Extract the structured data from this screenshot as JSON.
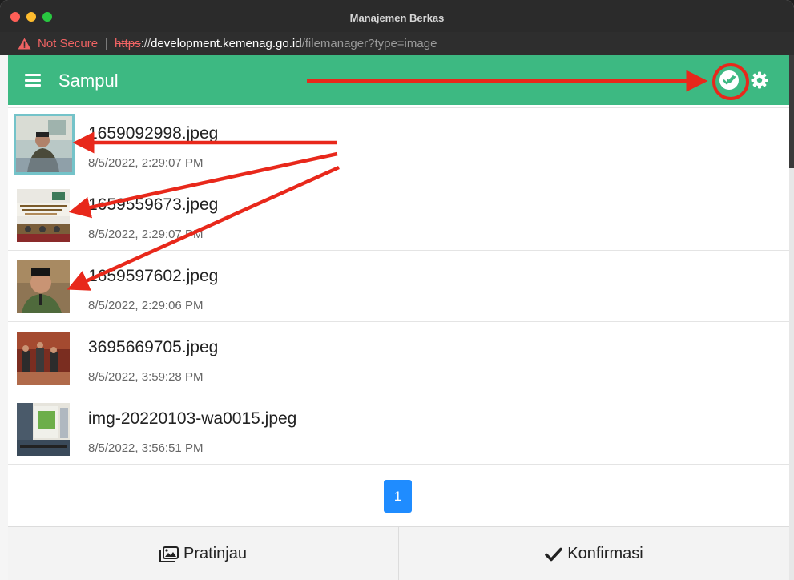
{
  "window": {
    "title": "Manajemen Berkas"
  },
  "address_bar": {
    "security_label": "Not Secure",
    "scheme": "https",
    "scheme_sep": "://",
    "host": "development.kemenag.go.id",
    "path": "/filemanager?type=image"
  },
  "app_bar": {
    "title": "Sampul",
    "menu_icon": "hamburger-icon",
    "actions": [
      "check-all-icon",
      "gear-icon"
    ],
    "color": "#3db982"
  },
  "files": [
    {
      "name": "1659092998.jpeg",
      "date": "8/5/2022, 2:29:07 PM",
      "selected": true
    },
    {
      "name": "1659559673.jpeg",
      "date": "8/5/2022, 2:29:07 PM",
      "selected": false
    },
    {
      "name": "1659597602.jpeg",
      "date": "8/5/2022, 2:29:06 PM",
      "selected": false
    },
    {
      "name": "3695669705.jpeg",
      "date": "8/5/2022, 3:59:28 PM",
      "selected": false
    },
    {
      "name": "img-20220103-wa0015.jpeg",
      "date": "8/5/2022, 3:56:51 PM",
      "selected": false
    }
  ],
  "pagination": {
    "current": "1"
  },
  "footer": {
    "preview_label": "Pratinjau",
    "confirm_label": "Konfirmasi"
  },
  "colors": {
    "accent": "#3db982",
    "page_button": "#1f8cff",
    "annotation": "#e8281b",
    "warning": "#ef6363"
  }
}
